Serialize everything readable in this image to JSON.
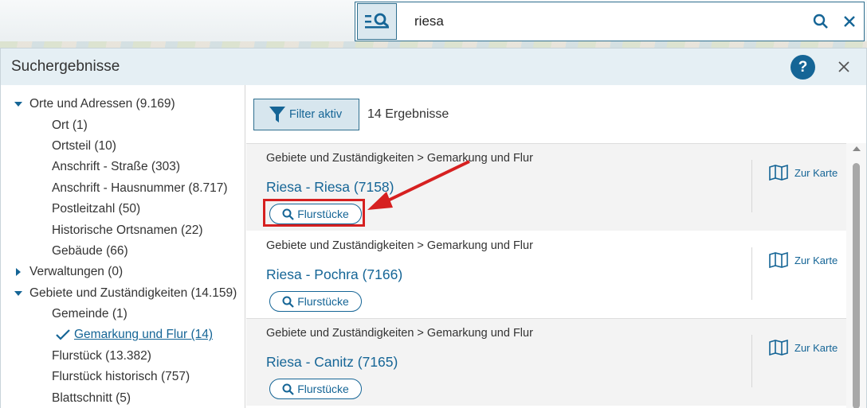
{
  "search": {
    "value": "riesa"
  },
  "panel": {
    "title": "Suchergebnisse",
    "help_label": "?"
  },
  "tree": [
    {
      "label": "Orte und Adressen (9.169)",
      "level": 0,
      "state": "expanded"
    },
    {
      "label": "Ort (1)",
      "level": 1
    },
    {
      "label": "Ortsteil (10)",
      "level": 1
    },
    {
      "label": "Anschrift - Straße (303)",
      "level": 1
    },
    {
      "label": "Anschrift - Hausnummer (8.717)",
      "level": 1
    },
    {
      "label": "Postleitzahl (50)",
      "level": 1
    },
    {
      "label": "Historische Ortsnamen (22)",
      "level": 1
    },
    {
      "label": "Gebäude (66)",
      "level": 1
    },
    {
      "label": "Verwaltungen (0)",
      "level": 0,
      "state": "collapsed"
    },
    {
      "label": "Gebiete und Zuständigkeiten (14.159)",
      "level": 0,
      "state": "expanded"
    },
    {
      "label": "Gemeinde (1)",
      "level": 1
    },
    {
      "label": "Gemarkung und Flur (14)",
      "level": 1,
      "selected": true
    },
    {
      "label": "Flurstück (13.382)",
      "level": 1
    },
    {
      "label": "Flurstück historisch (757)",
      "level": 1
    },
    {
      "label": "Blattschnitt (5)",
      "level": 1
    }
  ],
  "toolbar": {
    "filter_label": "Filter aktiv",
    "result_count": "14 Ergebnisse"
  },
  "results": [
    {
      "breadcrumb": "Gebiete und Zuständigkeiten > Gemarkung und Flur",
      "title": "Riesa - Riesa (7158)",
      "button": "Flurstücke",
      "map_link": "Zur Karte"
    },
    {
      "breadcrumb": "Gebiete und Zuständigkeiten > Gemarkung und Flur",
      "title": "Riesa - Pochra (7166)",
      "button": "Flurstücke",
      "map_link": "Zur Karte"
    },
    {
      "breadcrumb": "Gebiete und Zuständigkeiten > Gemarkung und Flur",
      "title": "Riesa - Canitz (7165)",
      "button": "Flurstücke",
      "map_link": "Zur Karte"
    }
  ],
  "colors": {
    "accent": "#156596",
    "annotation": "#d62020"
  }
}
